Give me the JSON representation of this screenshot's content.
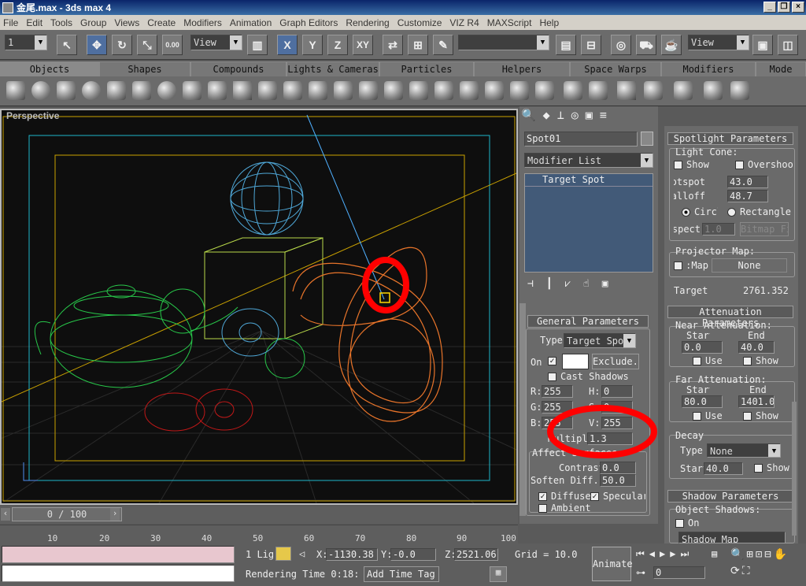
{
  "title": "金尾.max - 3ds max 4",
  "menu": [
    "File",
    "Edit",
    "Tools",
    "Group",
    "Views",
    "Create",
    "Modifiers",
    "Animation",
    "Graph Editors",
    "Rendering",
    "Customize",
    "VIZ R4",
    "MAXScript",
    "Help"
  ],
  "toolbar": {
    "select_value": "1",
    "ref_coord_left": "View",
    "ref_coord_right": "View",
    "axis_x": "X",
    "axis_y": "Y",
    "axis_z": "Z",
    "axis_xy": "XY"
  },
  "tabs": [
    "Objects",
    "Shapes",
    "Compounds",
    "Lights & Cameras",
    "Particles",
    "Helpers",
    "Space Warps",
    "Modifiers",
    "Mode"
  ],
  "viewport": {
    "label": "Perspective"
  },
  "time": {
    "slider": "0 / 100",
    "ticks": [
      "10",
      "20",
      "30",
      "40",
      "50",
      "60",
      "70",
      "80",
      "90",
      "100"
    ]
  },
  "status": {
    "count": "1 Lig",
    "x_label": "X:",
    "x": "-1130.38",
    "y_label": "Y:",
    "y": "-0.0",
    "z_label": "Z:",
    "z": "2521.06",
    "grid": "Grid = 10.0",
    "rendering_time": "Rendering Time  0:18:",
    "add_time_tag": "Add Time Tag",
    "animate": "Animate",
    "frame": "0"
  },
  "command_panel": {
    "object_name": "Spot01",
    "modifier_list": "Modifier List",
    "stack_item": "Target Spot",
    "general": {
      "header": "General Parameters",
      "type_label": "Type",
      "type_value": "Target Spot",
      "on_label": "On",
      "exclude": "Exclude...",
      "cast_shadows": "Cast Shadows",
      "r_label": "R:",
      "r": "255",
      "h_label": "H:",
      "h": "0",
      "g_label": "G:",
      "g": "255",
      "s_label": "S:",
      "s": "0",
      "b_label": "B:",
      "b": "255",
      "v_label": "V:",
      "v": "255",
      "multiplier_label": "Multiplier",
      "multiplier": "1.3"
    },
    "affect": {
      "header": "Affect Surfaces:",
      "contrast_label": "Contrast",
      "contrast": "0.0",
      "soften_label": "Soften Diff.",
      "soften": "50.0",
      "diffuse": "Diffuse",
      "specular": "Specular",
      "ambient": "Ambient"
    }
  },
  "spot_params": {
    "header": "Spotlight Parameters",
    "light_cone": "Light Cone:",
    "show": "Show",
    "overshoot": "Overshoot",
    "hotspot_label": "Hotspot:",
    "hotspot": "43.0",
    "falloff_label": "Falloff:",
    "falloff": "48.7",
    "circle": "Circle",
    "rectangle": "Rectangle",
    "aspect_label": "Aspect:",
    "aspect": "1.0",
    "bitmap_fit": "Bitmap Fit...",
    "projector_label": "Projector Map:",
    "map_label": "Map:",
    "map_value": "None",
    "target_label": "Target",
    "target_value": "2761.352"
  },
  "attenuation": {
    "header": "Attenuation Parameters",
    "near": "Near Attenuation:",
    "start": "Start",
    "end": "End",
    "near_start": "0.0",
    "near_end": "40.0",
    "use": "Use",
    "show": "Show",
    "far": "Far Attenuation:",
    "far_start": "80.0",
    "far_end": "1401.0"
  },
  "decay": {
    "header": "Decay",
    "type_label": "Type",
    "type_value": "None",
    "start_label": "Start",
    "start": "40.0",
    "show": "Show"
  },
  "shadow": {
    "header": "Shadow Parameters",
    "object_shadows": "Object Shadows:",
    "on": "On",
    "map_value": "Shadow Map"
  },
  "colors": {
    "accent": "#4f6fa0",
    "annotation": "#ff0000",
    "viewport_bg": "#0e0e0e"
  }
}
